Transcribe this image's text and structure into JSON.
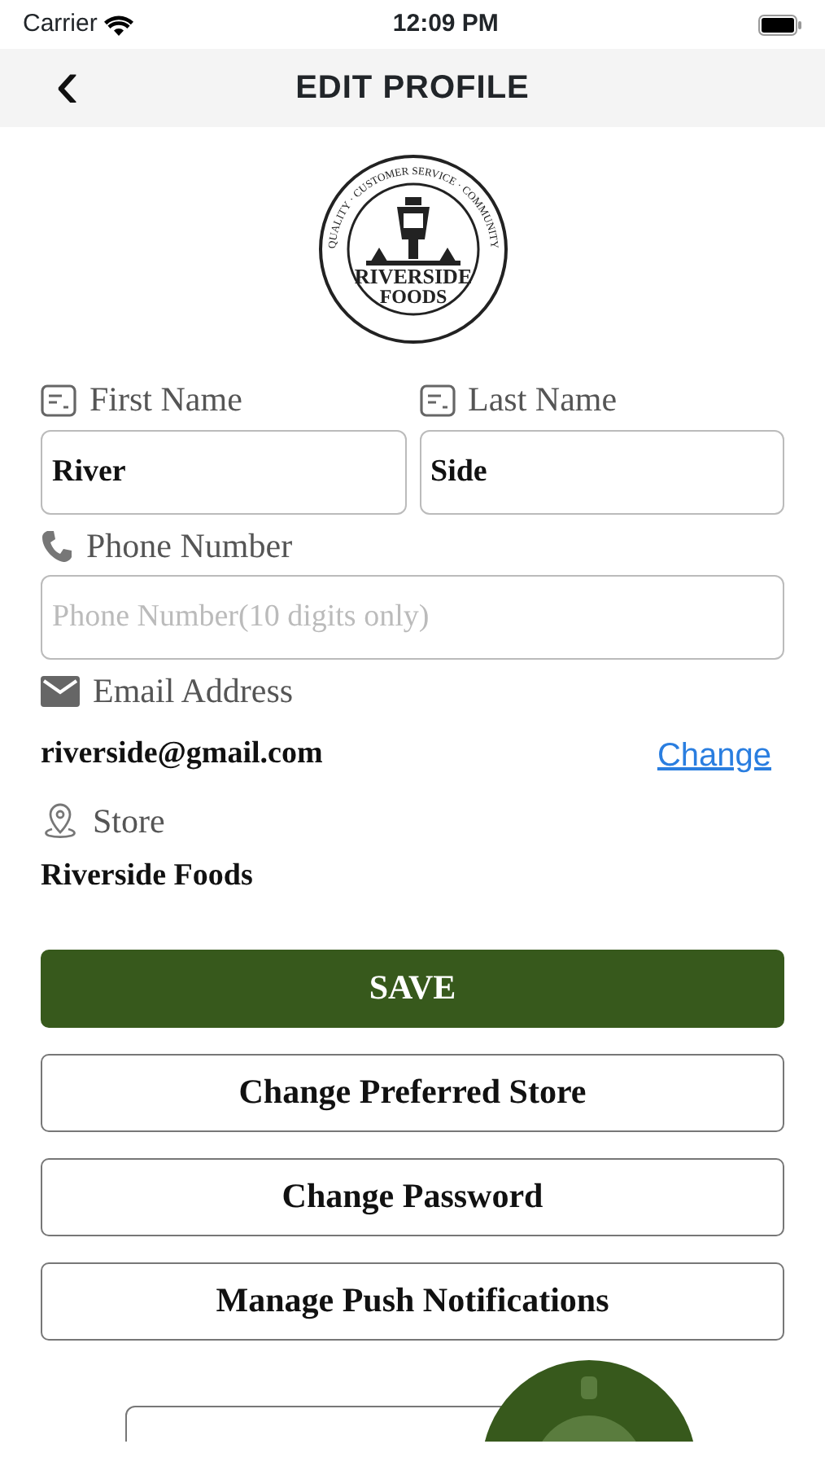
{
  "status_bar": {
    "carrier": "Carrier",
    "time": "12:09 PM"
  },
  "header": {
    "back": "‹",
    "title": "EDIT PROFILE"
  },
  "logo": {
    "ring_text": "QUALITY · CUSTOMER SERVICE · COMMUNITY",
    "name_lines": [
      "RIVERSIDE",
      "FOODS"
    ]
  },
  "fields": [
    {
      "kind": "name",
      "label": "First Name",
      "value": "River"
    },
    {
      "kind": "name",
      "label": "Last Name",
      "value": "Side"
    },
    {
      "kind": "phone",
      "label": "Phone Number",
      "placeholder": "Phone Number(10 digits only)"
    }
  ],
  "email": {
    "label": "Email Address",
    "value": "riverside@gmail.com",
    "link": "Change"
  },
  "store": {
    "label": "Store",
    "value": "Riverside Foods"
  },
  "buttons": [
    {
      "kind": "primary",
      "label": "SAVE"
    },
    {
      "kind": "outline",
      "label": "Change Preferred Store"
    },
    {
      "kind": "outline",
      "label": "Change Password"
    },
    {
      "kind": "outline",
      "label": "Manage Push Notifications"
    }
  ]
}
